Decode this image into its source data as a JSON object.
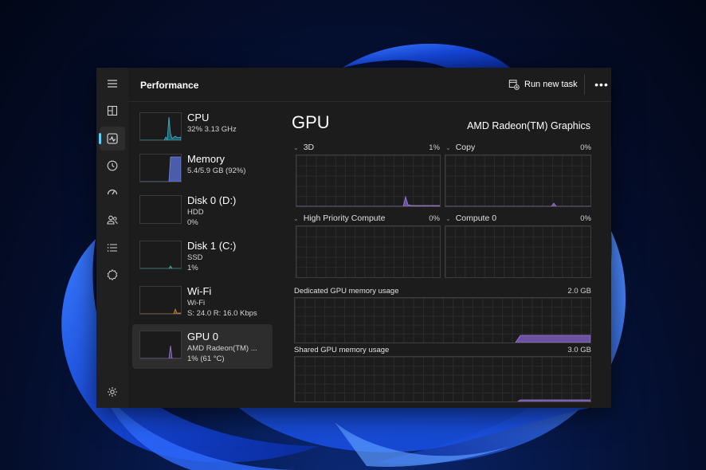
{
  "header": {
    "title": "Performance",
    "run_new_task": "Run new task",
    "more": "•••"
  },
  "nav": [
    {
      "name": "hamburger-menu-icon"
    },
    {
      "name": "processes-icon"
    },
    {
      "name": "performance-icon",
      "active": true
    },
    {
      "name": "app-history-icon"
    },
    {
      "name": "startup-apps-icon"
    },
    {
      "name": "users-icon"
    },
    {
      "name": "details-icon"
    },
    {
      "name": "services-icon"
    },
    {
      "name": "settings-icon"
    }
  ],
  "resources": [
    {
      "name": "CPU",
      "lines": [
        "32%  3.13 GHz"
      ],
      "color": "#3fb8c9"
    },
    {
      "name": "Memory",
      "lines": [
        "5.4/5.9 GB (92%)"
      ],
      "color": "#6f86d6"
    },
    {
      "name": "Disk 0 (D:)",
      "lines": [
        "HDD",
        "0%"
      ],
      "color": "#3fb8a4"
    },
    {
      "name": "Disk 1 (C:)",
      "lines": [
        "SSD",
        "1%"
      ],
      "color": "#3fb8a4"
    },
    {
      "name": "Wi-Fi",
      "lines": [
        "Wi-Fi",
        "S: 24.0  R: 16.0 Kbps"
      ],
      "color": "#c98a3f"
    },
    {
      "name": "GPU 0",
      "lines": [
        "AMD Radeon(TM) ...",
        "1% (61 °C)"
      ],
      "color": "#9b7fd1",
      "selected": true
    }
  ],
  "gpu": {
    "title": "GPU",
    "model": "AMD Radeon(TM) Graphics",
    "engines": [
      {
        "label": "3D",
        "percent": "1%"
      },
      {
        "label": "Copy",
        "percent": "0%"
      },
      {
        "label": "High Priority Compute",
        "percent": "0%"
      },
      {
        "label": "Compute 0",
        "percent": "0%"
      }
    ],
    "dedicated": {
      "label": "Dedicated GPU memory usage",
      "max": "2.0 GB"
    },
    "shared": {
      "label": "Shared GPU memory usage",
      "max": "3.0 GB"
    }
  },
  "colors": {
    "accent": "#60cdff",
    "gpu": "#9b7fd1",
    "window_bg": "#1c1c1c"
  }
}
